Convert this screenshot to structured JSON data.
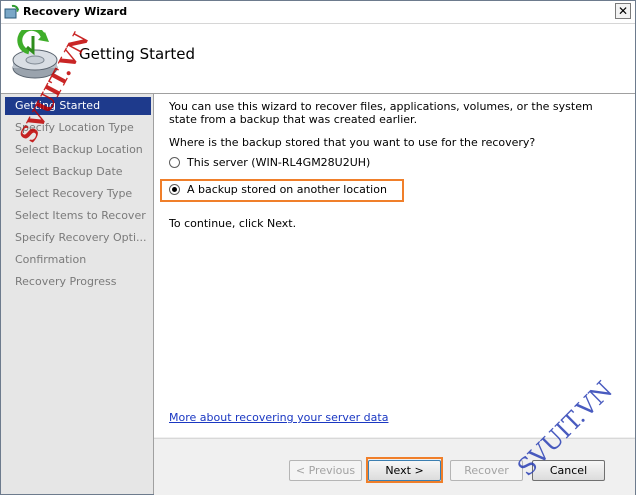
{
  "window": {
    "title": "Recovery Wizard",
    "close_glyph": "✕"
  },
  "header": {
    "title": "Getting Started",
    "icon": "backup-restore-icon"
  },
  "nav": {
    "items": [
      {
        "label": "Getting Started",
        "active": true
      },
      {
        "label": "Specify Location Type",
        "active": false
      },
      {
        "label": "Select Backup Location",
        "active": false
      },
      {
        "label": "Select Backup Date",
        "active": false
      },
      {
        "label": "Select Recovery Type",
        "active": false
      },
      {
        "label": "Select Items to Recover",
        "active": false
      },
      {
        "label": "Specify Recovery Opti...",
        "active": false
      },
      {
        "label": "Confirmation",
        "active": false
      },
      {
        "label": "Recovery Progress",
        "active": false
      }
    ]
  },
  "content": {
    "intro": "You can use this wizard to recover files, applications, volumes, or the system state from a backup that was created earlier.",
    "question": "Where is the backup stored that you want to use for the recovery?",
    "options": [
      {
        "label": "This server (WIN-RL4GM28U2UH)",
        "checked": false
      },
      {
        "label": "A backup stored on another location",
        "checked": true
      }
    ],
    "continue_text": "To continue, click Next.",
    "help_link": "More about recovering your server data"
  },
  "buttons": {
    "previous": "< Previous",
    "next": "Next >",
    "recover": "Recover",
    "cancel": "Cancel"
  },
  "watermarks": {
    "top_left": "SVUIT.VN",
    "bottom_right": "SVUIT.VN"
  },
  "colors": {
    "accent_highlight": "#f07f2a",
    "nav_active": "#1e3a8c",
    "link": "#1a37c2"
  }
}
